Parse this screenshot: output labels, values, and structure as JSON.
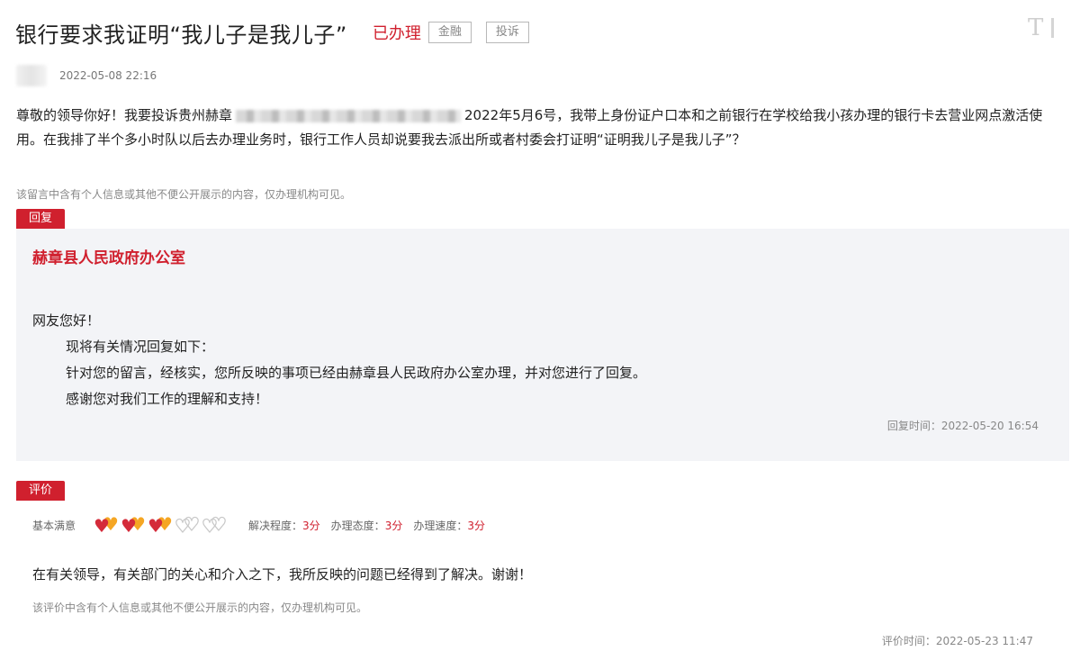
{
  "header": {
    "title": "银行要求我证明“我儿子是我儿子”",
    "status": "已办理",
    "tags": [
      "金融",
      "投诉"
    ],
    "font_icon": "text-size-icon"
  },
  "post": {
    "time": "2022-05-08 22:16",
    "content_part1": "尊敬的领导你好！我要投诉贵州赫章",
    "content_part2": "2022年5月6号，我带上身份证户口本和之前银行在学校给我小孩办理的银行卡去营业网点激活使用。在我排了半个多小时队以后去办理业务时，银行工作人员却说要我去派出所或者村委会打证明“证明我儿子是我儿子”？",
    "privacy_note": "该留言中含有个人信息或其他不便公开展示的内容，仅办理机构可见。"
  },
  "reply": {
    "label": "回复",
    "org": "赫章县人民政府办公室",
    "greeting": "网友您好！",
    "lines": [
      "现将有关情况回复如下：",
      "针对您的留言，经核实，您所反映的事项已经由赫章县人民政府办公室办理，并对您进行了回复。",
      "感谢您对我们工作的理解和支持！"
    ],
    "time": "回复时间：2022-05-20 16:54"
  },
  "evaluation": {
    "label": "评价",
    "satisfaction": "基本满意",
    "hearts_filled": 3,
    "hearts_total": 5,
    "scores": [
      {
        "label": "解决程度：",
        "value": "3分"
      },
      {
        "label": "办理态度：",
        "value": "3分"
      },
      {
        "label": "办理速度：",
        "value": "3分"
      }
    ],
    "comment": "在有关领导，有关部门的关心和介入之下，我所反映的问题已经得到了解决。谢谢！",
    "privacy_note": "该评价中含有个人信息或其他不便公开展示的内容，仅办理机构可见。",
    "time": "评价时间：2022-05-23 11:47"
  },
  "colors": {
    "accent": "#d0202e",
    "heart_front": "#d42b3a",
    "heart_back": "#f5a623"
  }
}
